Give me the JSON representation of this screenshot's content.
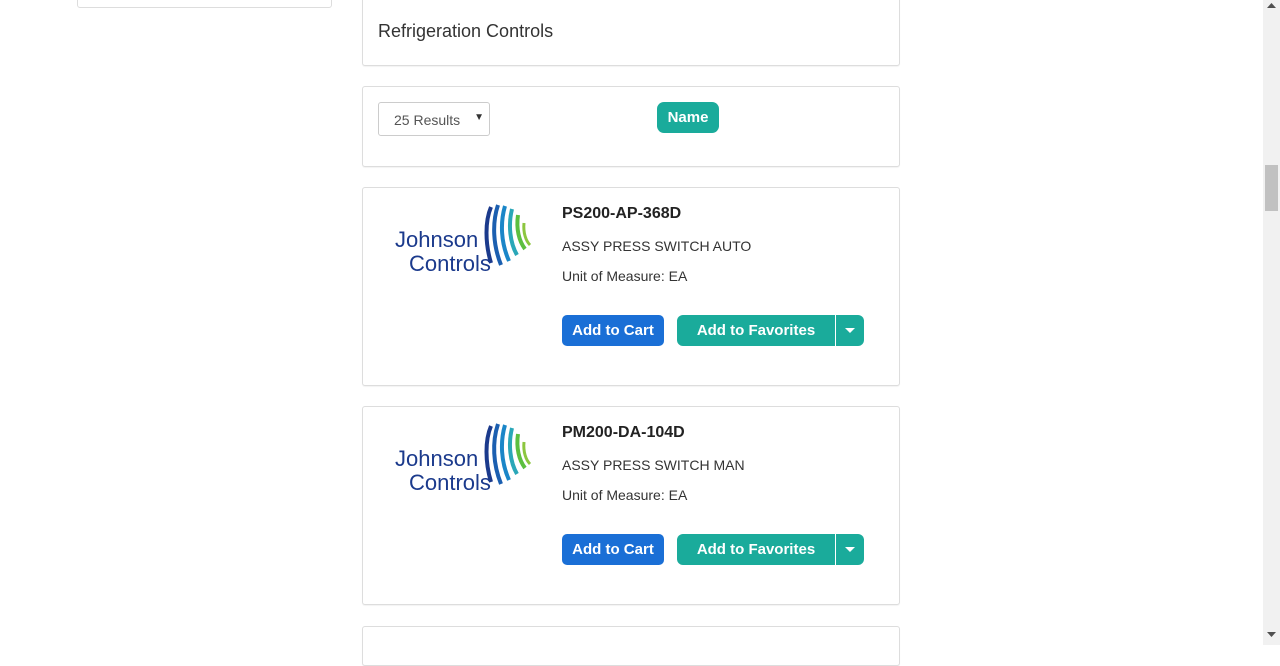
{
  "category": {
    "title": "Refrigeration Controls"
  },
  "sort": {
    "results_label": "25 Results",
    "name_button": "Name"
  },
  "brand": {
    "line1": "Johnson",
    "line2": "Controls"
  },
  "products": [
    {
      "name": "PS200-AP-368D",
      "description": "ASSY PRESS SWITCH AUTO",
      "uom": "Unit of Measure: EA",
      "add_to_cart": "Add to Cart",
      "add_to_favorites": "Add to Favorites"
    },
    {
      "name": "PM200-DA-104D",
      "description": "ASSY PRESS SWITCH MAN",
      "uom": "Unit of Measure: EA",
      "add_to_cart": "Add to Cart",
      "add_to_favorites": "Add to Favorites"
    }
  ],
  "colors": {
    "teal": "#1aab9b",
    "blue": "#1a6fd6",
    "logo_navy": "#1b3a8c"
  }
}
